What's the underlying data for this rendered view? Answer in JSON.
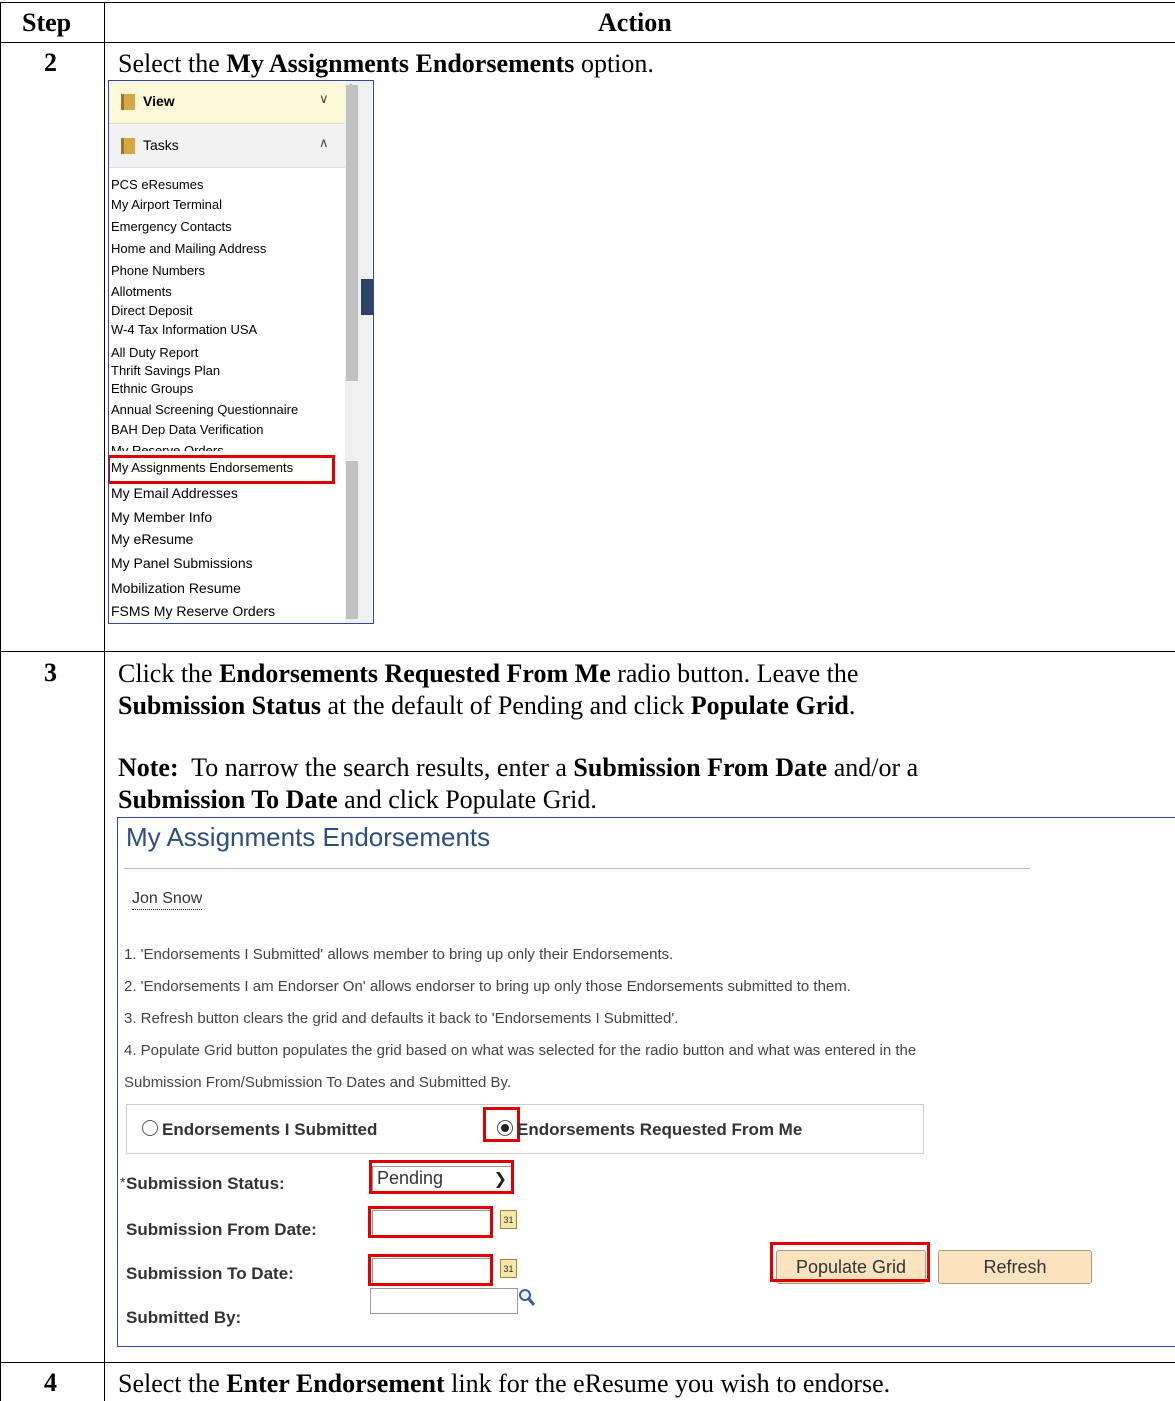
{
  "table": {
    "header_step": "Step",
    "header_action": "Action"
  },
  "step2": {
    "number": "2",
    "pre": "Select the ",
    "bold": "My Assignments Endorsements",
    "post": " option.",
    "sidebar": {
      "view_label": "View",
      "tasks_label": "Tasks",
      "items": [
        "PCS eResumes",
        "My Airport Terminal",
        "Emergency Contacts",
        "Home and Mailing Address",
        "Phone Numbers",
        "Allotments",
        "Direct Deposit",
        "W-4 Tax Information USA",
        "All Duty Report",
        "Thrift Savings Plan",
        "Ethnic Groups",
        "Annual Screening Questionnaire",
        "BAH Dep Data Verification",
        "My Reserve Orders",
        "My Assignments Endorsements",
        "My Email Addresses",
        "My Member Info",
        "My eResume",
        "My Panel Submissions",
        "Mobilization Resume",
        "FSMS My Reserve Orders"
      ]
    }
  },
  "step3": {
    "number": "3",
    "line1_a": "Click the ",
    "line1_b": "Endorsements Requested From Me",
    "line1_c": " radio button. Leave the",
    "line2_a": "Submission Status",
    "line2_b": " at the default of Pending and click ",
    "line2_c": "Populate Grid",
    "line2_d": ".",
    "note_a": "Note:",
    "note_b": "  To narrow the search results, enter a ",
    "note_c": "Submission From Date",
    "note_d": " and/or a",
    "note2_a": "Submission To Date",
    "note2_b": " and click Populate Grid.",
    "form": {
      "title": "My Assignments Endorsements",
      "user_name": "Jon Snow",
      "notes": [
        "1. 'Endorsements I Submitted' allows member to bring up only their Endorsements.",
        "2. 'Endorsements I am Endorser On' allows endorser to bring up only those Endorsements submitted to them.",
        "3. Refresh button clears the grid and defaults it back to 'Endorsements I Submitted'.",
        "4. Populate Grid button populates the grid based on what was selected for the radio button and what was entered in the",
        "Submission From/Submission To Dates and Submitted By."
      ],
      "radio_submitted": "Endorsements I Submitted",
      "radio_requested": "Endorsements Requested From Me",
      "required_mark": "*",
      "status_label": "Submission Status:",
      "status_value": "Pending",
      "from_label": "Submission From Date:",
      "to_label": "Submission To Date:",
      "submitted_by_label": "Submitted By:",
      "calendar_text": "31",
      "populate_button": "Populate Grid",
      "refresh_button": "Refresh"
    }
  },
  "step4": {
    "number": "4",
    "pre": "Select the ",
    "bold": "Enter Endorsement",
    "post": " link for the eResume you wish to endorse."
  }
}
